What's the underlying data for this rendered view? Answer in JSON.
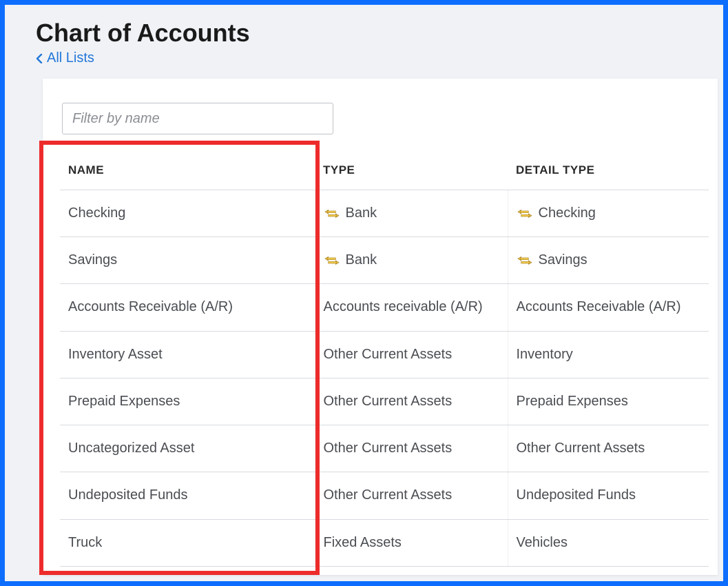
{
  "header": {
    "title": "Chart of Accounts",
    "back_link": "All Lists"
  },
  "filter": {
    "placeholder": "Filter by name"
  },
  "table": {
    "columns": {
      "name": "NAME",
      "type": "TYPE",
      "detail_type": "DETAIL TYPE"
    },
    "rows": [
      {
        "name": "Checking",
        "type": "Bank",
        "detail_type": "Checking",
        "type_icon": true,
        "detail_icon": true
      },
      {
        "name": "Savings",
        "type": "Bank",
        "detail_type": "Savings",
        "type_icon": true,
        "detail_icon": true
      },
      {
        "name": "Accounts Receivable (A/R)",
        "type": "Accounts receivable (A/R)",
        "detail_type": "Accounts Receivable (A/R)",
        "type_icon": false,
        "detail_icon": false
      },
      {
        "name": "Inventory Asset",
        "type": "Other Current Assets",
        "detail_type": "Inventory",
        "type_icon": false,
        "detail_icon": false
      },
      {
        "name": "Prepaid Expenses",
        "type": "Other Current Assets",
        "detail_type": "Prepaid Expenses",
        "type_icon": false,
        "detail_icon": false
      },
      {
        "name": "Uncategorized Asset",
        "type": "Other Current Assets",
        "detail_type": "Other Current Assets",
        "type_icon": false,
        "detail_icon": false
      },
      {
        "name": "Undeposited Funds",
        "type": "Other Current Assets",
        "detail_type": "Undeposited Funds",
        "type_icon": false,
        "detail_icon": false
      },
      {
        "name": "Truck",
        "type": "Fixed Assets",
        "detail_type": "Vehicles",
        "type_icon": false,
        "detail_icon": false
      }
    ]
  }
}
